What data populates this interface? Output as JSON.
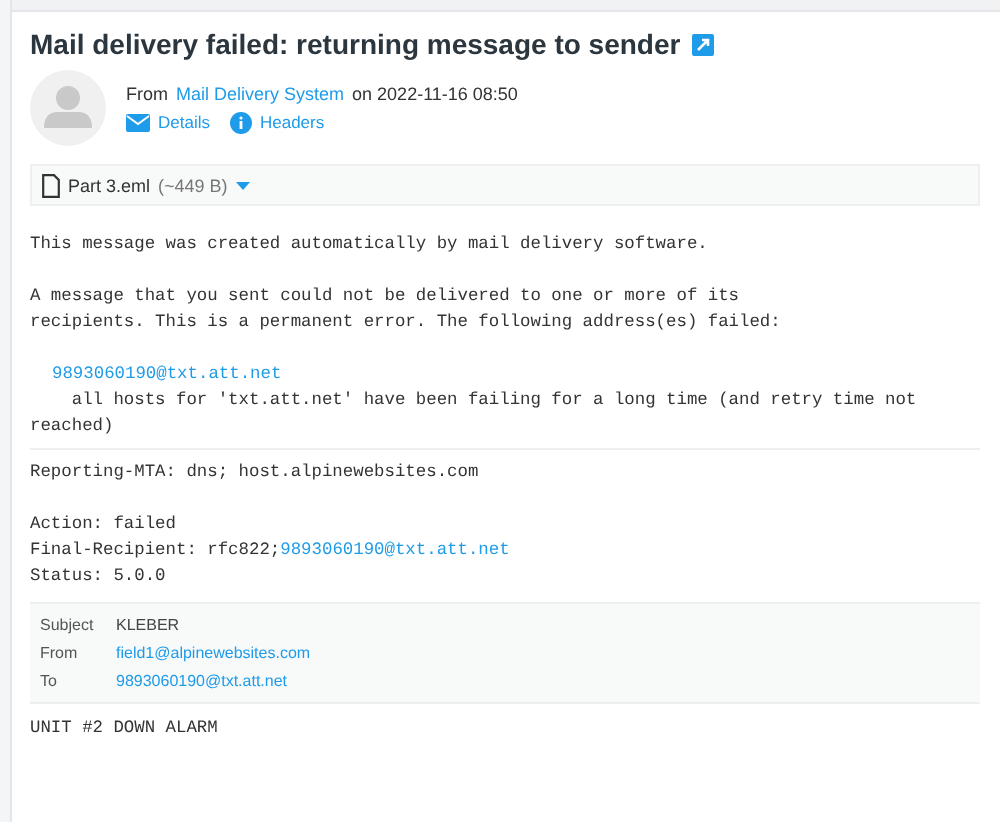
{
  "message": {
    "subject": "Mail delivery failed: returning message to sender",
    "from_label": "From",
    "sender": "Mail Delivery System",
    "on_label": "on",
    "date": "2022-11-16 08:50",
    "actions": [
      {
        "label": "Details",
        "kind": "envelope"
      },
      {
        "label": "Headers",
        "kind": "info"
      }
    ]
  },
  "attachment": {
    "name": "Part 3.eml",
    "size": "(~449 B)"
  },
  "body": {
    "intro": "This message was created automatically by mail delivery software.",
    "notice_lines": [
      "A message that you sent could not be delivered to one or more of its",
      "recipients. This is a permanent error. The following address(es) failed:"
    ],
    "failed_address": "9893060190@txt.att.net",
    "reason_lines": [
      "    all hosts for 'txt.att.net' have been failing for a long time (and retry time not",
      "reached)"
    ],
    "reporting_mta": "Reporting-MTA: dns; host.alpinewebsites.com",
    "action": "Action: failed",
    "final_recipient_label": "Final-Recipient: rfc822;",
    "final_recipient": "9893060190@txt.att.net",
    "status": "Status: 5.0.0"
  },
  "headers": [
    {
      "label": "Subject",
      "value": "KLEBER",
      "link": false
    },
    {
      "label": "From",
      "value": "field1@alpinewebsites.com",
      "link": true
    },
    {
      "label": "To",
      "value": "9893060190@txt.att.net",
      "link": true
    }
  ],
  "original_body": "UNIT #2 DOWN ALARM"
}
